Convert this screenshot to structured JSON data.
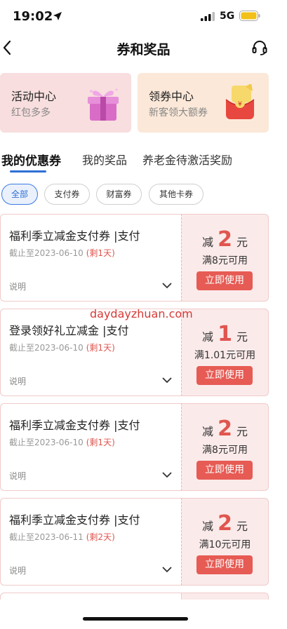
{
  "status_bar": {
    "time": "19:02",
    "network": "5G"
  },
  "nav": {
    "title": "券和奖品"
  },
  "centers": [
    {
      "title": "活动中心",
      "subtitle": "红包多多"
    },
    {
      "title": "领券中心",
      "subtitle": "新客领大额券"
    }
  ],
  "tabs": [
    "我的优惠券",
    "我的奖品",
    "养老金待激活奖励"
  ],
  "filters": [
    "全部",
    "支付券",
    "财富券",
    "其他卡券"
  ],
  "coupons": [
    {
      "title": "福利季立减金支付券 |支付",
      "expiry": "截止至2023-06-10",
      "remain": "(剩1天)",
      "desc": "说明",
      "amount_prefix": "减",
      "amount": "2",
      "amount_unit": "元",
      "condition": "满8元可用",
      "button": "立即使用"
    },
    {
      "title": "登录领好礼立减金 |支付",
      "expiry": "截止至2023-06-10",
      "remain": "(剩1天)",
      "desc": "说明",
      "amount_prefix": "减",
      "amount": "1",
      "amount_unit": "元",
      "condition": "满1.01元可用",
      "button": "立即使用"
    },
    {
      "title": "福利季立减金支付券 |支付",
      "expiry": "截止至2023-06-10",
      "remain": "(剩1天)",
      "desc": "说明",
      "amount_prefix": "减",
      "amount": "2",
      "amount_unit": "元",
      "condition": "满8元可用",
      "button": "立即使用"
    },
    {
      "title": "福利季立减金支付券 |支付",
      "expiry": "截止至2023-06-11",
      "remain": "(剩2天)",
      "desc": "说明",
      "amount_prefix": "减",
      "amount": "2",
      "amount_unit": "元",
      "condition": "满10元可用",
      "button": "立即使用"
    }
  ],
  "watermark": "daydayzhuan.com",
  "colors": {
    "accent_blue": "#2f6fd6",
    "coupon_red": "#e65b54",
    "coupon_bg": "#fbeaea"
  }
}
